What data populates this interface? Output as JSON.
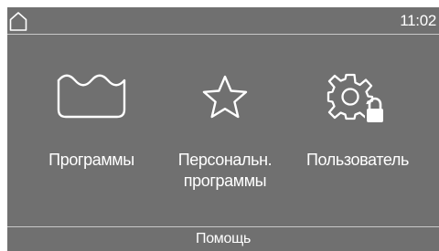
{
  "status_bar": {
    "home_icon": "home-icon",
    "time": "11:02"
  },
  "tiles": [
    {
      "icon": "washtub-icon",
      "label_lines": [
        "Программы"
      ]
    },
    {
      "icon": "star-outline-icon",
      "label_lines": [
        "Персональн.",
        "программы"
      ]
    },
    {
      "icon": "gear-lock-icon",
      "label_lines": [
        "Пользователь"
      ]
    }
  ],
  "footer": {
    "help_label": "Помощь"
  },
  "colors": {
    "background": "#707070",
    "foreground": "#ffffff",
    "divider": "#c8c8c8"
  }
}
